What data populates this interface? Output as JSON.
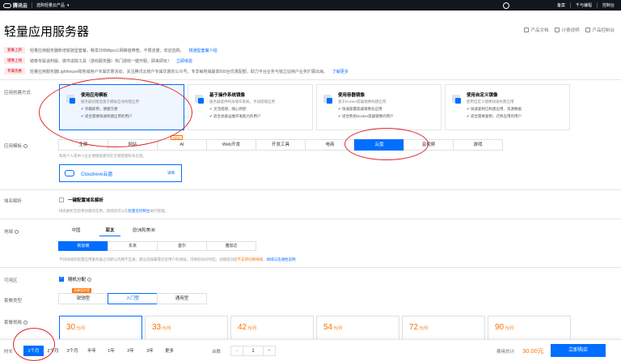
{
  "topbar": {
    "brand": "腾讯云",
    "product": "选购轻量云产品",
    "links": [
      "备案",
      "千与编程",
      "控制台"
    ]
  },
  "page_title": "轻量应用服务器",
  "title_links": [
    "产品文档",
    "计费说明",
    "产品控制台"
  ],
  "notices": [
    {
      "tag": "套餐上新",
      "text": "轻量应用服务器新增锐驰型套餐，畅享200Mbps公网峰值带宽，不限流量，欢迎选购。",
      "link": "锐驰型套餐介绍"
    },
    {
      "tag": "镜像上线",
      "text": "镜像专属谈判版、做市追踪工具（游戏服务器）热门游戏一键开服，即来即玩！",
      "link": "立即体验"
    },
    {
      "tag": "专属优惠",
      "text": "轻量应用服务器Lighthouse跨地域用户专属优惠活动，关注腾讯云账户专属优惠的公众号，专享每地域最高500台优惠配额，助力平台业务与独立站用户业务扩展出海。",
      "link": "了解更多"
    }
  ],
  "creation": {
    "label": "应用创建方式",
    "methods": [
      {
        "title": "使用应用模板",
        "desc": "服务器创建后基于模板自动构建应用",
        "features": [
          "开箱即用，便捷方便",
          "适合需要快速构建应用的用户"
        ]
      },
      {
        "title": "基于操作系统镜像",
        "desc": "服务器提供纯净操作系统，手动搭建应用",
        "features": [
          "灵活搭建，随心所欲",
          "适合具备运维开发能力的用户"
        ]
      },
      {
        "title": "使用容器镜像",
        "desc": "基于Docker容器镜像构建应用",
        "features": [
          "快速部署容器镜像化应用",
          "适合熟悉Docker容器镜像的用户"
        ]
      },
      {
        "title": "使用自定义镜像",
        "desc": "使用自定义镜像快速构建应用",
        "features": [
          "快速复制已构建应用、资源数据",
          "适合需要复制、迁移应用的用户"
        ]
      }
    ]
  },
  "template": {
    "label": "应用模板",
    "tabs": [
      "全部",
      "网站",
      "AI",
      "Web开发",
      "开发工具",
      "电商",
      "云盘",
      "音视频",
      "游戏"
    ],
    "ai_badge": "NEW",
    "active": "云盘",
    "hint": "帮助个人或中小企业便捷搭建的在云端搭建私有云盘。",
    "app_name": "Cloudreve云盘",
    "app_detail": "详情"
  },
  "domain": {
    "label": "域名解析",
    "checkbox_label": "一键配置域名解析",
    "hint": "域名解析至您将创建的实例，后续您可以在",
    "hint_link": "轻量云控制台",
    "hint_end": "进行管理。"
  },
  "region": {
    "label": "地域",
    "tabs": [
      "中国",
      "亚太",
      "欧洲和美洲"
    ],
    "active_tab": "亚太",
    "cities": [
      "新加坡",
      "东京",
      "首尔",
      "雅加达"
    ],
    "active_city": "新加坡",
    "hint": "不同地域的轻量应用服务器之间默认内网不互通；建议选择最靠近您用户的地域，可降低访问时延；创建成功后",
    "hint_warn": "不支持切换地域",
    "hint_link": "地域与连通性说明"
  },
  "zone": {
    "label": "可用区",
    "checkbox_label": "随机分配"
  },
  "package_type": {
    "label": "套餐类型",
    "options": [
      "锐驰型",
      "入门型",
      "通用型"
    ],
    "active": "入门型",
    "badge": "高峰值带宽"
  },
  "plans": {
    "label": "套餐规格",
    "prices": [
      "30",
      "33",
      "42",
      "54",
      "72",
      "90"
    ],
    "unit": "元/月",
    "selected": "30"
  },
  "bottom": {
    "duration_label": "时长",
    "durations": [
      "1个月",
      "2个月",
      "3个月",
      "半年",
      "1年",
      "2年",
      "3年",
      "更多"
    ],
    "active_duration": "1个月",
    "qty_label": "台数",
    "qty_minus": "−",
    "qty_value": "1",
    "qty_plus": "+",
    "total_label": "费用总计",
    "total_value": "30.00元",
    "buy_label": "立即购买"
  }
}
